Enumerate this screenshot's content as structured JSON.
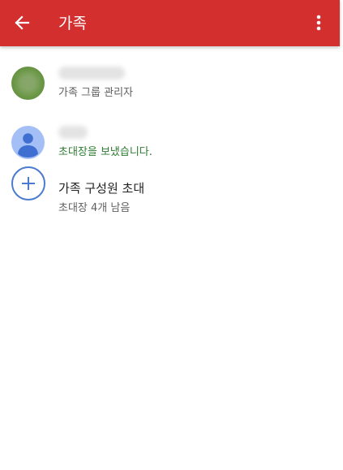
{
  "app_bar": {
    "title": "가족",
    "color": "#d32f2f"
  },
  "members": [
    {
      "role": "가족 그룹 관리자"
    },
    {
      "status": "초대장을 보냈습니다."
    }
  ],
  "invite": {
    "label": "가족 구성원 초대",
    "remaining": "초대장 4개 남음"
  },
  "icons": {
    "back": "arrow-back-icon",
    "menu": "more-vert-icon",
    "add": "add-circle-icon",
    "default_avatar": "person-icon"
  },
  "colors": {
    "accent_blue": "#4b7ad1",
    "sent_green": "#2e7d32"
  }
}
